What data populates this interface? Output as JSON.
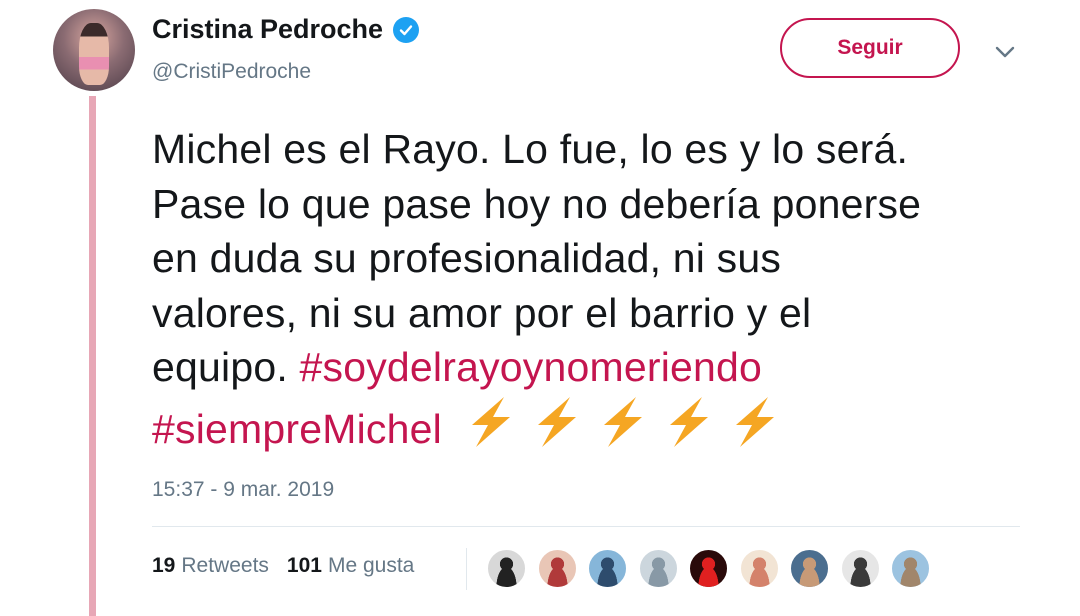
{
  "colors": {
    "accent": "#c4154f",
    "thread_line": "#e7a7b6",
    "verified": "#1da1f2",
    "secondary_text": "#657786",
    "bolt": "#f5a623"
  },
  "author": {
    "name": "Cristina Pedroche",
    "handle": "@CristiPedroche",
    "verified_icon": "verified-badge-icon"
  },
  "follow_button": {
    "label": "Seguir"
  },
  "menu_icon": "chevron-down-icon",
  "tweet": {
    "lines": [
      "Michel es el Rayo. Lo fue, lo es y lo será.",
      "Pase lo que pase hoy no debería ponerse",
      "en duda su profesionalidad, ni sus",
      "valores, ni su amor por el barrio y el"
    ],
    "last_text": "equipo.",
    "hashtag1": "#soydelrayoynomeriendo",
    "hashtag2": "#siempreMichel",
    "emoji": "high-voltage-icon",
    "emoji_count": 5
  },
  "timestamp": "15:37 - 9 mar. 2019",
  "stats": {
    "retweets_count": "19",
    "retweets_label": "Retweets",
    "likes_count": "101",
    "likes_label": "Me gusta"
  },
  "likers": [
    {
      "name": "liker-avatar-1",
      "bg": "#d8d8d8",
      "fg": "#222222"
    },
    {
      "name": "liker-avatar-2",
      "bg": "#e9c6b6",
      "fg": "#b03a3a"
    },
    {
      "name": "liker-avatar-3",
      "bg": "#86b6d9",
      "fg": "#2e4c6d"
    },
    {
      "name": "liker-avatar-4",
      "bg": "#ccd6dd",
      "fg": "#8899a6"
    },
    {
      "name": "liker-avatar-5",
      "bg": "#2a0a0a",
      "fg": "#e02020"
    },
    {
      "name": "liker-avatar-6",
      "bg": "#f2e4d4",
      "fg": "#d4826b"
    },
    {
      "name": "liker-avatar-7",
      "bg": "#4b6e8f",
      "fg": "#c79a77"
    },
    {
      "name": "liker-avatar-8",
      "bg": "#e6e6e6",
      "fg": "#3a3a3a"
    },
    {
      "name": "liker-avatar-9",
      "bg": "#9cc3e0",
      "fg": "#a1866b"
    }
  ]
}
